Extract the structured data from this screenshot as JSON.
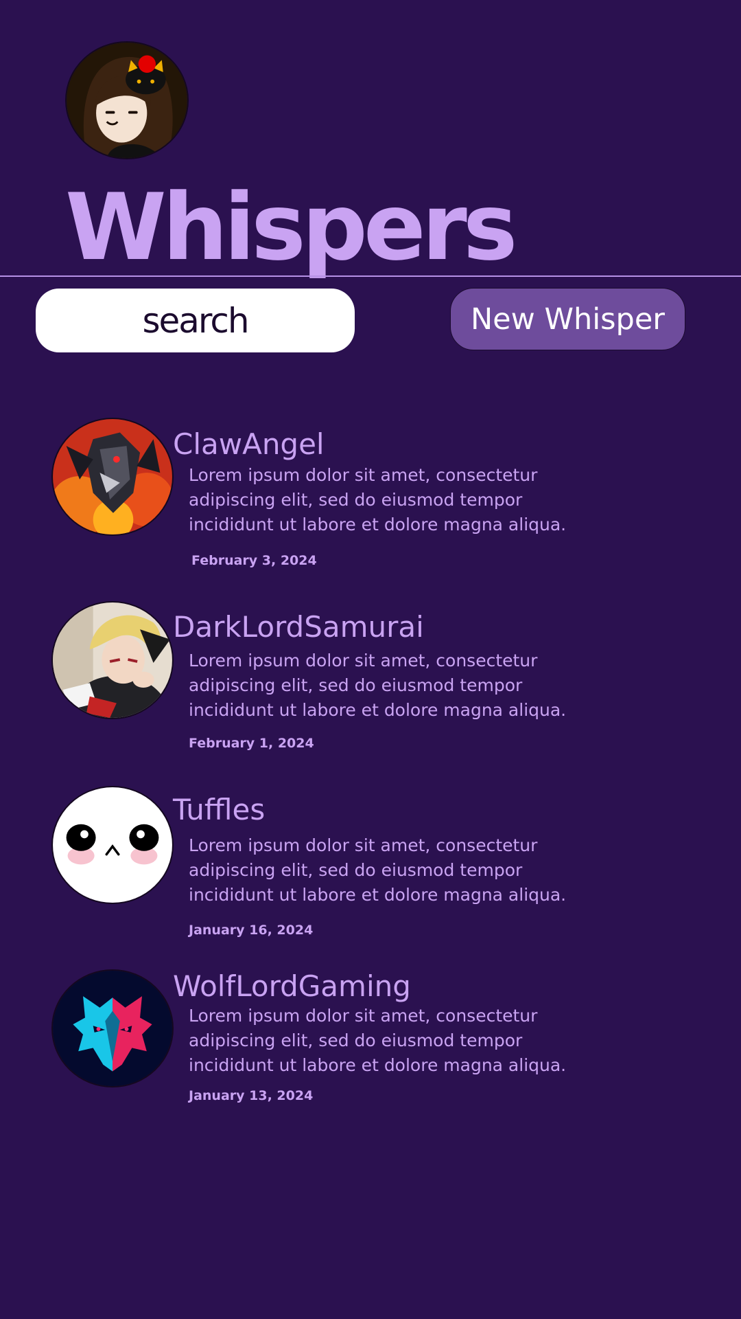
{
  "app": {
    "title": "Whispers",
    "profile_avatar": "user-profile-avatar"
  },
  "search": {
    "placeholder": "search"
  },
  "toolbar": {
    "new_whisper_label": "New Whisper"
  },
  "posts": [
    {
      "avatar": "dragon-avatar",
      "username": "ClawAngel",
      "body": "Lorem ipsum dolor sit amet, consectetur adipiscing elit, sed do eiusmod tempor incididunt ut labore et dolore magna aliqua.",
      "date": "February 3, 2024"
    },
    {
      "avatar": "anime-boy-avatar",
      "username": "DarkLordSamurai",
      "body": "Lorem ipsum dolor sit amet, consectetur adipiscing elit, sed do eiusmod tempor incididunt ut labore et dolore magna aliqua.",
      "date": "February 1, 2024"
    },
    {
      "avatar": "cute-face-avatar",
      "username": "Tuffles",
      "body": "Lorem ipsum dolor sit amet, consectetur adipiscing elit, sed do eiusmod tempor incididunt ut labore et dolore magna aliqua.",
      "date": "January 16, 2024"
    },
    {
      "avatar": "wolf-avatar",
      "username": "WolfLordGaming",
      "body": "Lorem ipsum dolor sit amet, consectetur adipiscing elit, sed do eiusmod tempor incididunt ut labore et dolore magna aliqua.",
      "date": "January 13, 2024"
    }
  ],
  "colors": {
    "background": "#2b1150",
    "accent": "#c9a3f2",
    "button": "#6e4c9c",
    "divider": "#b691e6",
    "search_bg": "#ffffff"
  }
}
